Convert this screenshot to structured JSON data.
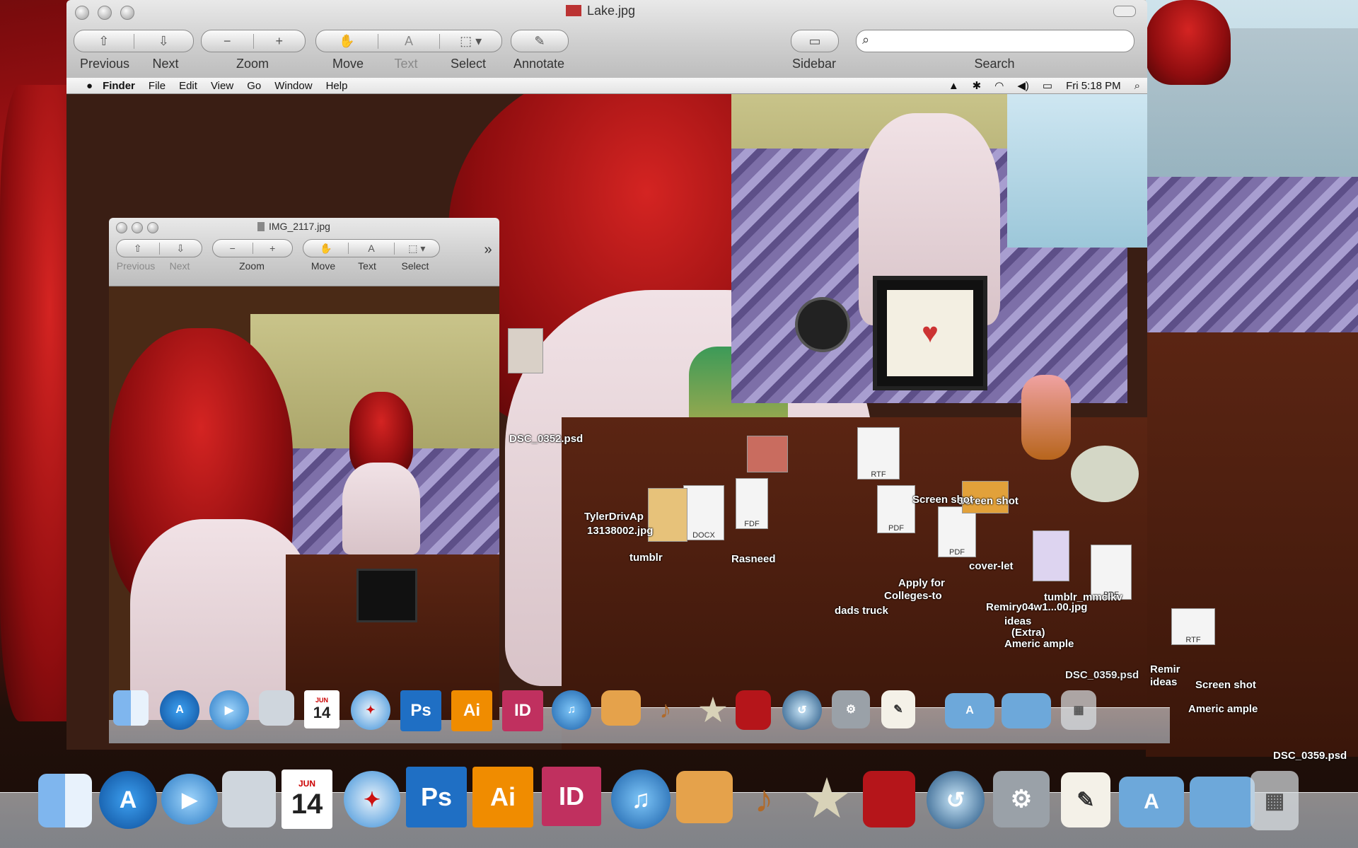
{
  "main_window": {
    "title": "Lake.jpg",
    "toolbar": {
      "previous": "Previous",
      "next": "Next",
      "zoom": "Zoom",
      "move": "Move",
      "text": "Text",
      "select": "Select",
      "annotate": "Annotate",
      "sidebar": "Sidebar",
      "search": "Search",
      "zoom_out_glyph": "−",
      "zoom_in_glyph": "+"
    }
  },
  "menubar": {
    "items": [
      "Finder",
      "File",
      "Edit",
      "View",
      "Go",
      "Window",
      "Help"
    ],
    "clock": "Fri 5:18 PM"
  },
  "inner_window": {
    "title": "IMG_2117.jpg",
    "toolbar": {
      "previous": "Previous",
      "next": "Next",
      "zoom": "Zoom",
      "move": "Move",
      "text": "Text",
      "select": "Select",
      "overflow": "»"
    }
  },
  "dock": {
    "calendar_month": "JUN",
    "calendar_day": "14",
    "photoshop": "Ps",
    "illustrator": "Ai",
    "indesign": "ID",
    "icons": [
      "finder-icon",
      "app-store-icon",
      "facetime-icon",
      "photo-booth-icon",
      "ical-icon",
      "safari-icon",
      "photoshop-icon",
      "illustrator-icon",
      "indesign-icon",
      "itunes-icon",
      "iphoto-icon",
      "garageband-icon",
      "imovie-icon",
      "front-row-icon",
      "time-machine-icon",
      "system-preferences-icon",
      "textedit-icon",
      "applications-folder-icon",
      "documents-folder-icon",
      "trash-icon"
    ]
  },
  "scattered_files": [
    "RTF",
    "PDF",
    "PDF",
    "DOCX",
    "PDF",
    "RTF",
    "FDF",
    "DSC_0359.psd",
    "Remiry04w1...00.jpg",
    "ideas",
    "(Extra)",
    "Americ ample",
    "Screen shot",
    "Colleges-to",
    "Apply for",
    "tumblr_mmclkv",
    "Rasneed",
    "dads truck",
    "Screen shot",
    "13138002.jpg",
    "TylerDrivAp",
    "DSC_0352.psd",
    "tumblr",
    "cover-let",
    "DSC_0359.psd",
    "Screen shot",
    "Americ ample",
    "ideas",
    "Remir"
  ],
  "colors": {
    "hair_red": "#c0171a",
    "ps_blue": "#1f6fc4",
    "ai_orange": "#f08c00",
    "id_pink": "#c0305f"
  }
}
